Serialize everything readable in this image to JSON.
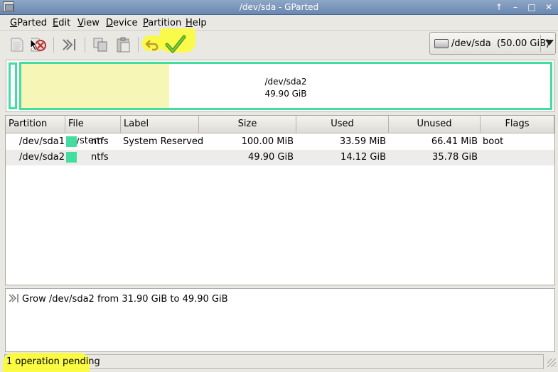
{
  "window": {
    "title": "/dev/sda - GParted",
    "buttons": [
      "↑",
      "–",
      "□",
      "✕"
    ]
  },
  "menubar": {
    "items": [
      {
        "pre": "",
        "mn": "G",
        "post": "Parted"
      },
      {
        "pre": "",
        "mn": "E",
        "post": "dit"
      },
      {
        "pre": "",
        "mn": "V",
        "post": "iew"
      },
      {
        "pre": "",
        "mn": "D",
        "post": "evice"
      },
      {
        "pre": "",
        "mn": "P",
        "post": "artition"
      },
      {
        "pre": "",
        "mn": "H",
        "post": "elp"
      }
    ]
  },
  "toolbar": {
    "icons": [
      "new-icon",
      "delete-icon",
      "resize-move-icon",
      "copy-icon",
      "paste-icon",
      "undo-icon",
      "apply-icon"
    ],
    "highlight_color": "#fcfc3a"
  },
  "device": {
    "label": "/dev/sda",
    "size": "(50.00 GiB)"
  },
  "diskmap": {
    "partition_name": "/dev/sda2",
    "partition_size": "49.90 GiB",
    "ntfs_color": "#44dda0",
    "used_fraction": 0.28
  },
  "table": {
    "headers": [
      "Partition",
      "File System",
      "Label",
      "Size",
      "Used",
      "Unused",
      "Flags"
    ],
    "rows": [
      {
        "partition": "/dev/sda1",
        "fs": "ntfs",
        "label": "System Reserved",
        "size": "100.00 MiB",
        "used": "33.59 MiB",
        "unused": "66.41 MiB",
        "flags": "boot"
      },
      {
        "partition": "/dev/sda2",
        "fs": "ntfs",
        "label": "",
        "size": "49.90 GiB",
        "used": "14.12 GiB",
        "unused": "35.78 GiB",
        "flags": ""
      }
    ]
  },
  "operations": {
    "items": [
      "Grow /dev/sda2 from 31.90 GiB to 49.90 GiB"
    ]
  },
  "status": {
    "text": "1 operation pending"
  }
}
